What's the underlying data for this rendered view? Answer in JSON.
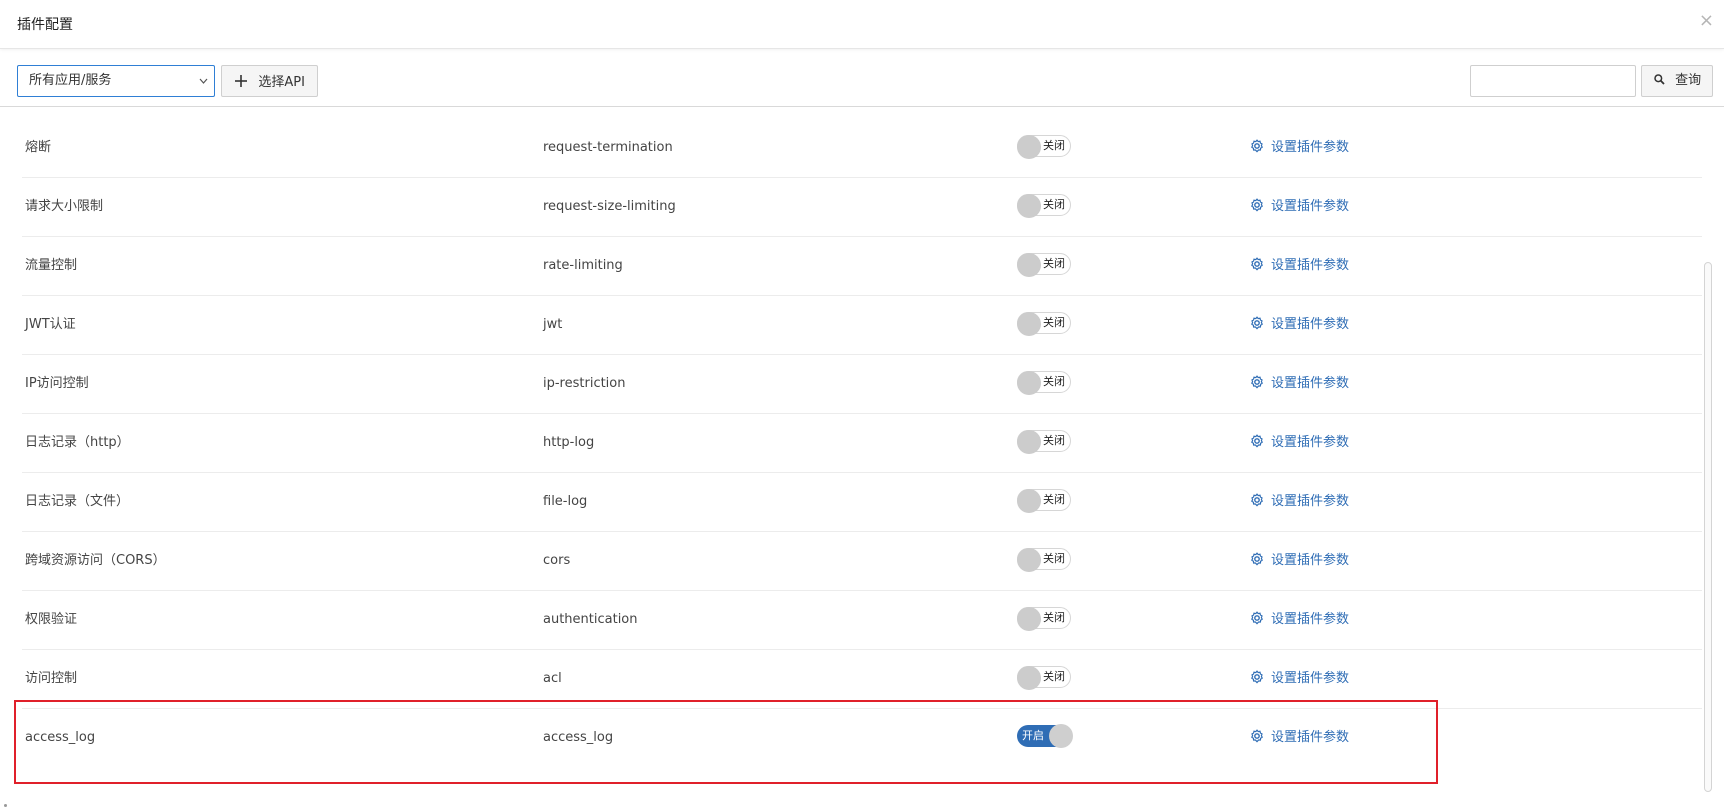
{
  "dialog": {
    "title": "插件配置",
    "close_glyph": "×"
  },
  "toolbar": {
    "scope_select_value": "所有应用/服务",
    "select_api_label": "选择API",
    "search_value": "",
    "query_label": "查询"
  },
  "plugins": [
    {
      "name": "熔断",
      "code": "request-termination",
      "enabled": false,
      "toggle_label": "关闭",
      "action_label": "设置插件参数"
    },
    {
      "name": "请求大小限制",
      "code": "request-size-limiting",
      "enabled": false,
      "toggle_label": "关闭",
      "action_label": "设置插件参数"
    },
    {
      "name": "流量控制",
      "code": "rate-limiting",
      "enabled": false,
      "toggle_label": "关闭",
      "action_label": "设置插件参数"
    },
    {
      "name": "JWT认证",
      "code": "jwt",
      "enabled": false,
      "toggle_label": "关闭",
      "action_label": "设置插件参数"
    },
    {
      "name": "IP访问控制",
      "code": "ip-restriction",
      "enabled": false,
      "toggle_label": "关闭",
      "action_label": "设置插件参数"
    },
    {
      "name": "日志记录（http）",
      "code": "http-log",
      "enabled": false,
      "toggle_label": "关闭",
      "action_label": "设置插件参数"
    },
    {
      "name": "日志记录（文件）",
      "code": "file-log",
      "enabled": false,
      "toggle_label": "关闭",
      "action_label": "设置插件参数"
    },
    {
      "name": "跨域资源访问（CORS）",
      "code": "cors",
      "enabled": false,
      "toggle_label": "关闭",
      "action_label": "设置插件参数"
    },
    {
      "name": "权限验证",
      "code": "authentication",
      "enabled": false,
      "toggle_label": "关闭",
      "action_label": "设置插件参数"
    },
    {
      "name": "访问控制",
      "code": "acl",
      "enabled": false,
      "toggle_label": "关闭",
      "action_label": "设置插件参数"
    },
    {
      "name": "access_log",
      "code": "access_log",
      "enabled": true,
      "toggle_label": "开启",
      "action_label": "设置插件参数"
    }
  ],
  "colors": {
    "accent": "#2f6db5",
    "highlight_border": "#e0202a"
  },
  "icons": {
    "close": "close-icon",
    "plus": "plus-icon",
    "search": "search-icon",
    "gear": "gear-icon",
    "chevron": "chevron-down-icon"
  }
}
